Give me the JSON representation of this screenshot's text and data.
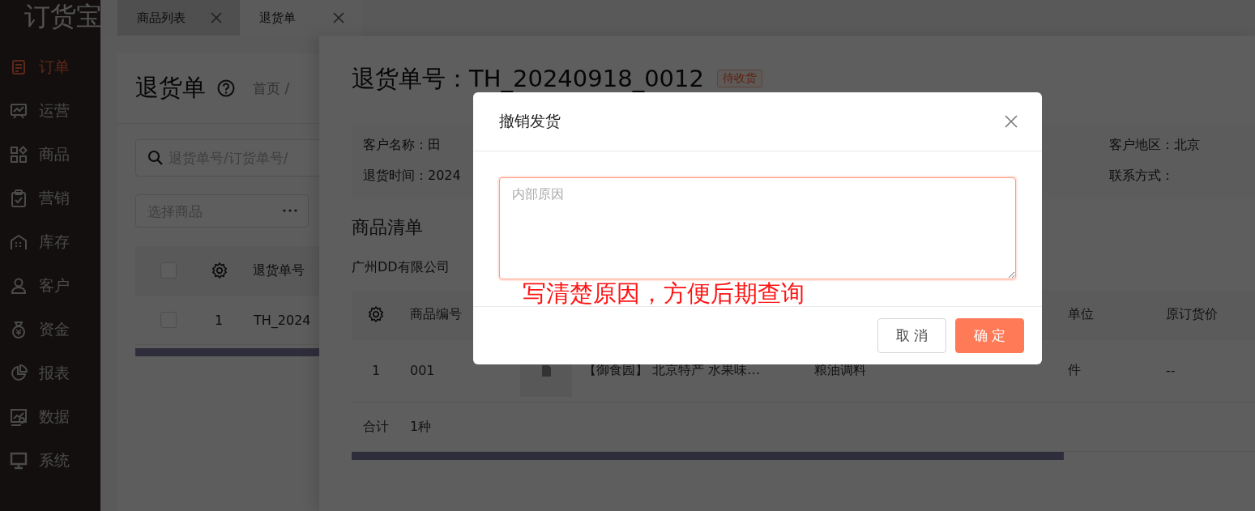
{
  "logo": "订货宝",
  "sidebar": {
    "items": [
      {
        "label": "订单",
        "selected": true
      },
      {
        "label": "运营",
        "selected": false
      },
      {
        "label": "商品",
        "selected": false
      },
      {
        "label": "营销",
        "selected": false
      },
      {
        "label": "库存",
        "selected": false
      },
      {
        "label": "客户",
        "selected": false
      },
      {
        "label": "资金",
        "selected": false
      },
      {
        "label": "报表",
        "selected": false
      },
      {
        "label": "数据",
        "selected": false
      },
      {
        "label": "系统",
        "selected": false
      }
    ]
  },
  "tabs": [
    {
      "label": "商品列表",
      "selected": false
    },
    {
      "label": "退货单",
      "selected": true
    }
  ],
  "list_page": {
    "title": "退货单",
    "breadcrumb": "首页 /",
    "search": {
      "placeholder": "退货单号/订货单号/"
    },
    "product_select": {
      "placeholder": "选择商品"
    },
    "table": {
      "header_checked": false,
      "column": "退货单号",
      "rows": [
        {
          "checked": false,
          "index": "1",
          "return_no": "TH_2024"
        }
      ]
    }
  },
  "drawer": {
    "title": "退货单号：TH_20240918_0012",
    "status": "待收货",
    "info_left": [
      "客户名称：田",
      "退货时间：2024"
    ],
    "info_right": [
      "客户地区：北京",
      "联系方式："
    ],
    "section_title": "商品清单",
    "supplier": "广州DD有限公司",
    "table": {
      "header": {
        "code": "商品编号",
        "unit": "单位",
        "price": "原订货价"
      },
      "rows": [
        {
          "index": "1",
          "code": "001",
          "name": "【御食园】 北京特产 水果味…",
          "category": "粮油调料",
          "unit": "件",
          "price": "--"
        }
      ],
      "footer": {
        "label": "合计",
        "value": "1种"
      }
    }
  },
  "modal": {
    "title": "撤销发货",
    "placeholder": "内部原因",
    "annotation": "写清楚原因，方便后期查询",
    "buttons": [
      {
        "label": "取 消",
        "kind": "secondary"
      },
      {
        "label": "确 定",
        "kind": "primary"
      }
    ]
  }
}
